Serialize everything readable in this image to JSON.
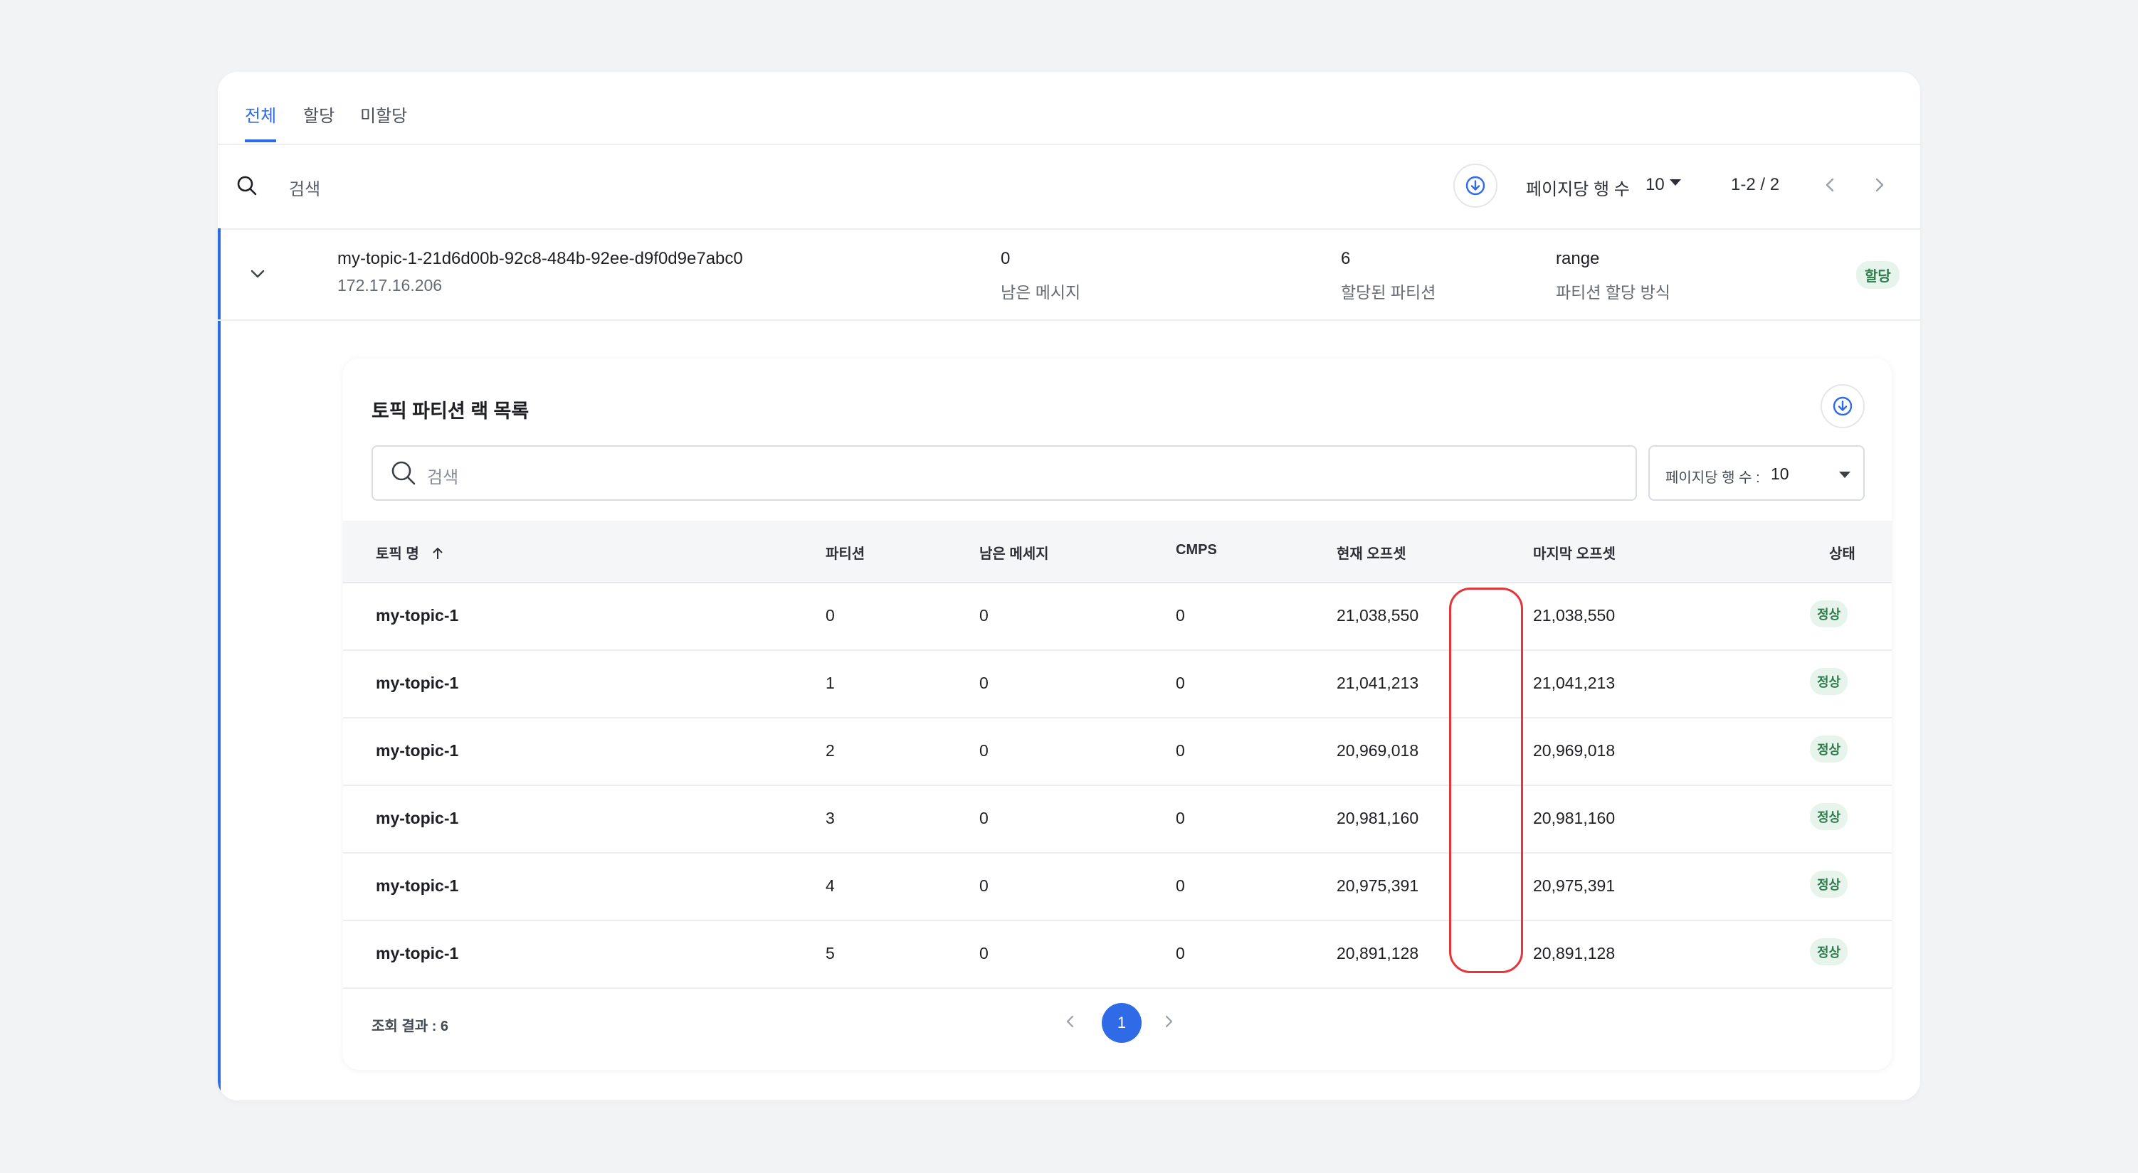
{
  "tabs": [
    {
      "label": "전체"
    },
    {
      "label": "할당"
    },
    {
      "label": "미할당"
    }
  ],
  "toolbar": {
    "search_label": "검색",
    "rows_per_page_label": "페이지당 행 수",
    "rows_per_page_value": "10",
    "range_text": "1-2 / 2"
  },
  "group": {
    "title": "my-topic-1-21d6d00b-92c8-484b-92ee-d9f0d9e7abc0",
    "subtitle": "172.17.16.206",
    "remaining_messages_value": "0",
    "remaining_messages_label": "남은 메시지",
    "assigned_partitions_value": "6",
    "assigned_partitions_label": "할당된 파티션",
    "assignment_method_value": "range",
    "assignment_method_label": "파티션 할당 방식",
    "badge": "할당"
  },
  "panel": {
    "title": "토픽 파티션 랙 목록",
    "search_placeholder": "검색",
    "rows_per_page_label": "페이지당 행 수 :",
    "rows_per_page_value": "10",
    "columns": [
      "토픽 명",
      "파티션",
      "남은 메세지",
      "CMPS",
      "현재 오프셋",
      "마지막 오프셋",
      "상태"
    ],
    "rows": [
      {
        "name": "my-topic-1",
        "partition": "0",
        "remaining": "0",
        "cmps": "0",
        "current": "21,038,550",
        "last": "21,038,550",
        "status": "정상"
      },
      {
        "name": "my-topic-1",
        "partition": "1",
        "remaining": "0",
        "cmps": "0",
        "current": "21,041,213",
        "last": "21,041,213",
        "status": "정상"
      },
      {
        "name": "my-topic-1",
        "partition": "2",
        "remaining": "0",
        "cmps": "0",
        "current": "20,969,018",
        "last": "20,969,018",
        "status": "정상"
      },
      {
        "name": "my-topic-1",
        "partition": "3",
        "remaining": "0",
        "cmps": "0",
        "current": "20,981,160",
        "last": "20,981,160",
        "status": "정상"
      },
      {
        "name": "my-topic-1",
        "partition": "4",
        "remaining": "0",
        "cmps": "0",
        "current": "20,975,391",
        "last": "20,975,391",
        "status": "정상"
      },
      {
        "name": "my-topic-1",
        "partition": "5",
        "remaining": "0",
        "cmps": "0",
        "current": "20,891,128",
        "last": "20,891,128",
        "status": "정상"
      }
    ],
    "result_count": "조회 결과 : 6",
    "current_page": "1"
  },
  "colors": {
    "accent": "#2f6be6",
    "status_bg": "#e7f4ec",
    "status_text": "#2e7d4c",
    "highlight": "#e5343a"
  }
}
